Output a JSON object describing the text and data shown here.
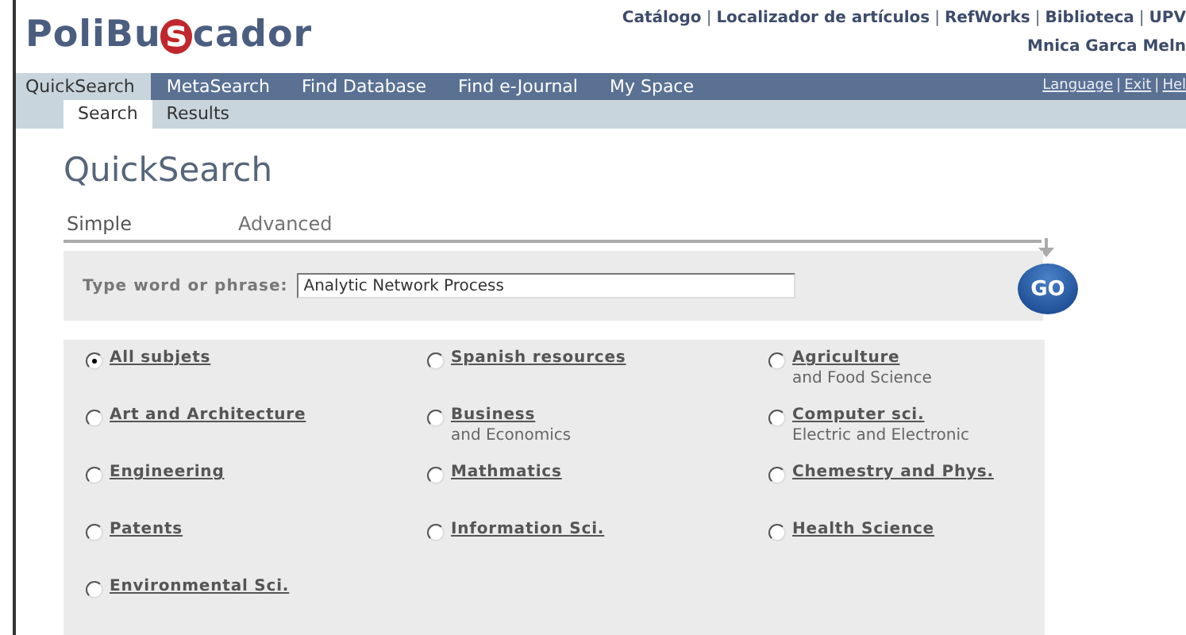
{
  "logo": {
    "before": "PoliBu",
    "mark": "s",
    "after": "cador"
  },
  "top_links": [
    {
      "kind": "link",
      "text": "Catálogo"
    },
    {
      "kind": "separator",
      "text": "|"
    },
    {
      "kind": "link",
      "text": "Localizador de artículos"
    },
    {
      "kind": "separator",
      "text": "|"
    },
    {
      "kind": "link",
      "text": "RefWorks"
    },
    {
      "kind": "separator",
      "text": "|"
    },
    {
      "kind": "link",
      "text": "Biblioteca"
    },
    {
      "kind": "separator",
      "text": "|"
    },
    {
      "kind": "link",
      "text": "UPV"
    }
  ],
  "user": "Mnica Garca Meln",
  "nav_tabs": [
    {
      "label": "QuickSearch",
      "selected": true
    },
    {
      "label": "MetaSearch",
      "selected": false
    },
    {
      "label": "Find Database",
      "selected": false
    },
    {
      "label": "Find e-Journal",
      "selected": false
    },
    {
      "label": "My Space",
      "selected": false
    }
  ],
  "nav_links": [
    {
      "kind": "link",
      "text": "Language"
    },
    {
      "kind": "separator",
      "text": "|"
    },
    {
      "kind": "link",
      "text": "Exit"
    },
    {
      "kind": "separator",
      "text": "|"
    },
    {
      "kind": "link",
      "text": "Hel"
    }
  ],
  "sub_tabs": [
    {
      "label": "Search",
      "selected": true
    },
    {
      "label": "Results",
      "selected": false
    }
  ],
  "page_title": "QuickSearch",
  "mode_tabs": [
    {
      "label": "Simple",
      "selected": true
    },
    {
      "label": "Advanced",
      "selected": false
    }
  ],
  "search": {
    "label": "Type word or phrase:",
    "value": "Analytic Network Process",
    "button": "GO"
  },
  "subjects": [
    {
      "label": "All subjets",
      "selected": true
    },
    {
      "label": "Spanish resources",
      "selected": false
    },
    {
      "label": "Agriculture",
      "note": "and Food Science",
      "selected": false
    },
    {
      "label": "Art and Architecture",
      "selected": false
    },
    {
      "label": "Business",
      "note": "and Economics",
      "selected": false
    },
    {
      "label": "Computer sci.",
      "note": "Electric and Electronic",
      "selected": false
    },
    {
      "label": "Engineering",
      "selected": false
    },
    {
      "label": "Mathmatics",
      "selected": false
    },
    {
      "label": "Chemestry and Phys.",
      "selected": false
    },
    {
      "label": "Patents",
      "selected": false
    },
    {
      "label": "Information Sci.",
      "selected": false
    },
    {
      "label": "Health Science",
      "selected": false
    },
    {
      "label": "Environmental Sci.",
      "selected": false
    }
  ]
}
